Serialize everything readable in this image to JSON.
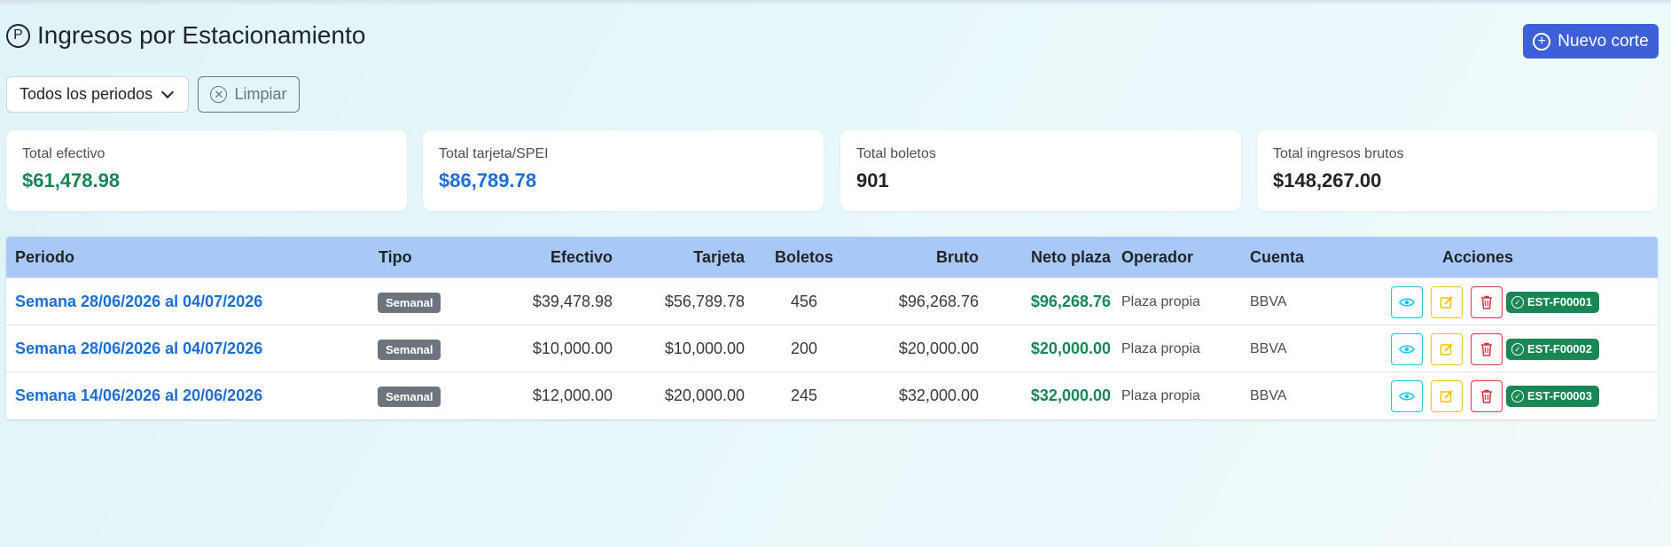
{
  "header": {
    "icon": "parking-circle-icon",
    "icon_glyph": "P",
    "title": "Ingresos por Estacionamiento"
  },
  "actions": {
    "new_label": "Nuevo corte",
    "new_icon": "plus-circle-icon"
  },
  "filters": {
    "period_select": "Todos los periodos",
    "clear_label": "Limpiar",
    "clear_icon": "x-circle-icon"
  },
  "colors": {
    "primary": "#3d5fd8",
    "success": "#198754",
    "link": "#1c6fd8",
    "table_header": "#a8c8f8"
  },
  "summary": {
    "cash_label": "Total efectivo",
    "cash_value": "$61,478.98",
    "card_label": "Total tarjeta/SPEI",
    "card_value": "$86,789.78",
    "tickets_label": "Total boletos",
    "tickets_value": "901",
    "gross_label": "Total ingresos brutos",
    "gross_value": "$148,267.00"
  },
  "table": {
    "columns": {
      "periodo": "Periodo",
      "tipo": "Tipo",
      "efectivo": "Efectivo",
      "tarjeta": "Tarjeta",
      "boletos": "Boletos",
      "bruto": "Bruto",
      "neto": "Neto plaza",
      "operador": "Operador",
      "cuenta": "Cuenta",
      "acciones": "Acciones"
    },
    "rows": [
      {
        "periodo": "Semana 28/06/2026 al 04/07/2026",
        "tipo": "Semanal",
        "efectivo": "$39,478.98",
        "tarjeta": "$56,789.78",
        "boletos": "456",
        "bruto": "$96,268.76",
        "neto": "$96,268.76",
        "operador": "Plaza propia",
        "cuenta": "BBVA",
        "folio": "EST-F00001"
      },
      {
        "periodo": "Semana 28/06/2026 al 04/07/2026",
        "tipo": "Semanal",
        "efectivo": "$10,000.00",
        "tarjeta": "$10,000.00",
        "boletos": "200",
        "bruto": "$20,000.00",
        "neto": "$20,000.00",
        "operador": "Plaza propia",
        "cuenta": "BBVA",
        "folio": "EST-F00002"
      },
      {
        "periodo": "Semana 14/06/2026 al 20/06/2026",
        "tipo": "Semanal",
        "efectivo": "$12,000.00",
        "tarjeta": "$20,000.00",
        "boletos": "245",
        "bruto": "$32,000.00",
        "neto": "$32,000.00",
        "operador": "Plaza propia",
        "cuenta": "BBVA",
        "folio": "EST-F00003"
      }
    ]
  }
}
